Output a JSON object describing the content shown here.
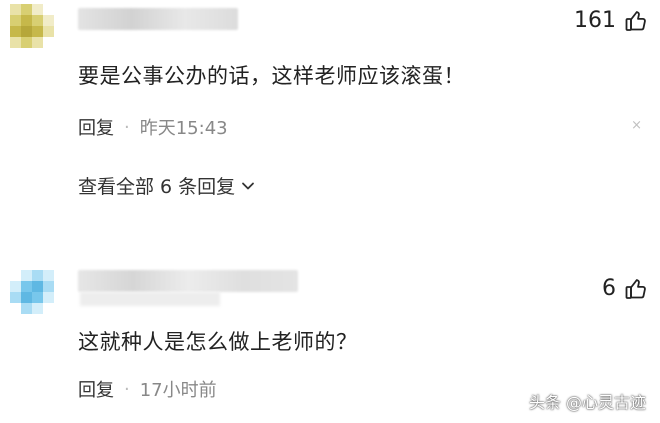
{
  "comments": [
    {
      "likes": "161",
      "text": "要是公事公办的话，这样老师应该滚蛋！",
      "reply_label": "回复",
      "time": "昨天15:43",
      "close_glyph": "×",
      "view_all": "查看全部 6 条回复",
      "avatar_colors": [
        "#c6b84a",
        "#d8cf72",
        "#e9e2a8",
        "#f1ecc8"
      ]
    },
    {
      "likes": "6",
      "text": "这就种人是怎么做上老师的？",
      "reply_label": "回复",
      "time": "17小时前",
      "avatar_colors": [
        "#78c7ec",
        "#a9dcf4",
        "#5fb8e3",
        "#d3eefa"
      ]
    }
  ],
  "watermark": "头条 @心灵古迹",
  "icons": {
    "like": "thumbs-up-icon",
    "close": "close-icon",
    "expand": "chevron-down-icon"
  },
  "colors": {
    "text": "#222222",
    "meta": "#888888"
  }
}
